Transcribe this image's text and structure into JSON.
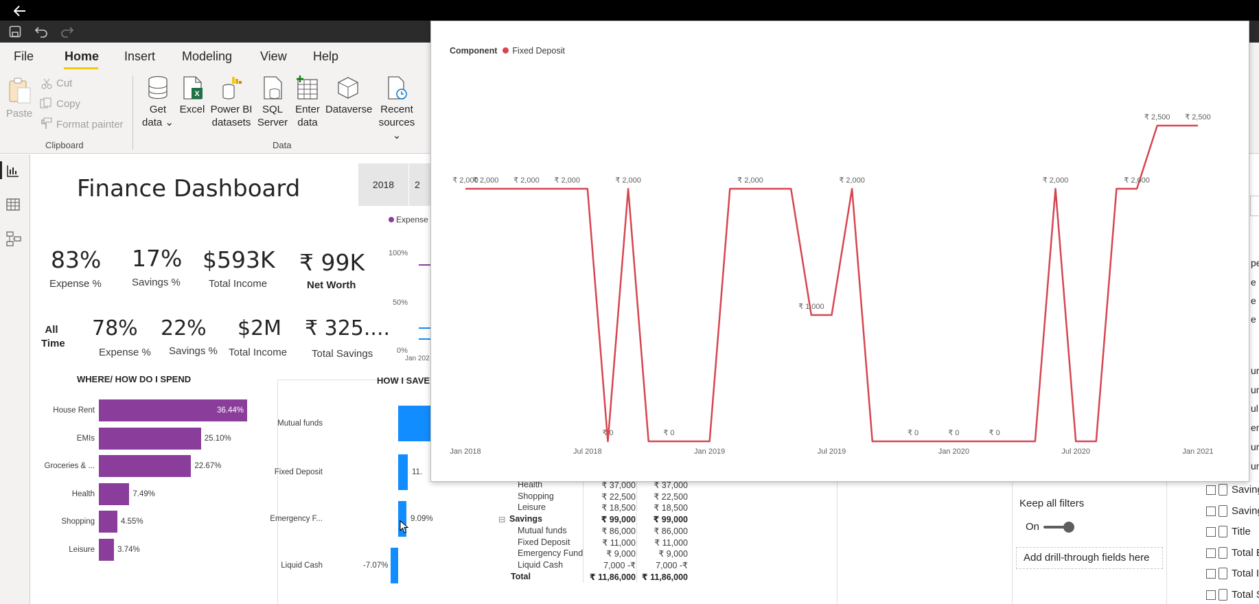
{
  "app": {
    "menu": [
      "File",
      "Home",
      "Insert",
      "Modeling",
      "View",
      "Help"
    ],
    "active_menu": "Home"
  },
  "ribbon": {
    "clipboard": {
      "paste": "Paste",
      "cut": "Cut",
      "copy": "Copy",
      "format_painter": "Format painter",
      "group": "Clipboard"
    },
    "data": {
      "group": "Data",
      "buttons": [
        {
          "line1": "Get",
          "line2": "data ⌄"
        },
        {
          "line1": "Excel",
          "line2": ""
        },
        {
          "line1": "Power BI",
          "line2": "datasets"
        },
        {
          "line1": "SQL",
          "line2": "Server"
        },
        {
          "line1": "Enter",
          "line2": "data"
        },
        {
          "line1": "Dataverse",
          "line2": ""
        },
        {
          "line1": "Recent",
          "line2": "sources ⌄"
        }
      ]
    }
  },
  "dashboard": {
    "title": "Finance Dashboard",
    "year_slicer": [
      "2018",
      "2"
    ],
    "legend_fragment": "Expense",
    "bg_axis": [
      "100%",
      "50%",
      "0%",
      "Jan 202"
    ],
    "kpis_period": [
      {
        "value": "83%",
        "label": "Expense %"
      },
      {
        "value": "17%",
        "label": "Savings %"
      },
      {
        "value": "$593K",
        "label": "Total Income"
      },
      {
        "value": "₹ 99K",
        "label": "Net Worth"
      }
    ],
    "all_time_label": [
      "All",
      "Time"
    ],
    "kpis_alltime": [
      {
        "value": "78%",
        "label": "Expense %"
      },
      {
        "value": "22%",
        "label": "Savings %"
      },
      {
        "value": "$2M",
        "label": "Total Income"
      },
      {
        "value": "₹ 325....",
        "label": "Total Savings"
      }
    ],
    "spend": {
      "title": "WHERE/ HOW DO I SPEND",
      "color": "#8a3d9b",
      "items": [
        {
          "label": "House Rent",
          "value": 36.44,
          "text": "36.44%"
        },
        {
          "label": "EMIs",
          "value": 25.1,
          "text": "25.10%"
        },
        {
          "label": "Groceries & ...",
          "value": 22.67,
          "text": "22.67%"
        },
        {
          "label": "Health",
          "value": 7.49,
          "text": "7.49%"
        },
        {
          "label": "Shopping",
          "value": 4.55,
          "text": "4.55%"
        },
        {
          "label": "Leisure",
          "value": 3.74,
          "text": "3.74%"
        }
      ]
    },
    "save": {
      "title": "HOW I SAVE",
      "color": "#118dff",
      "items": [
        {
          "label": "Mutual funds",
          "value": null,
          "text": ""
        },
        {
          "label": "Fixed Deposit",
          "value": 11,
          "text": "11."
        },
        {
          "label": "Emergency F...",
          "value": 9.09,
          "text": "9.09%"
        },
        {
          "label": "Liquid Cash",
          "value": -7.07,
          "text": "-7.07%"
        }
      ]
    },
    "matrix": {
      "rows": [
        {
          "label": "Health",
          "c1": "₹ 37,000",
          "c2": "₹ 37,000",
          "bold": false,
          "indent": true
        },
        {
          "label": "Shopping",
          "c1": "₹ 22,500",
          "c2": "₹ 22,500",
          "bold": false,
          "indent": true
        },
        {
          "label": "Leisure",
          "c1": "₹ 18,500",
          "c2": "₹ 18,500",
          "bold": false,
          "indent": true
        },
        {
          "label": "Savings",
          "c1": "₹ 99,000",
          "c2": "₹ 99,000",
          "bold": true,
          "indent": false,
          "toggle": "⊟"
        },
        {
          "label": "Mutual funds",
          "c1": "₹ 86,000",
          "c2": "₹ 86,000",
          "bold": false,
          "indent": true
        },
        {
          "label": "Fixed Deposit",
          "c1": "₹ 11,000",
          "c2": "₹ 11,000",
          "bold": false,
          "indent": true
        },
        {
          "label": "Emergency Fund",
          "c1": "₹ 9,000",
          "c2": "₹ 9,000",
          "bold": false,
          "indent": true
        },
        {
          "label": "Liquid Cash",
          "c1": "7,000 -₹",
          "c2": "7,000 -₹",
          "bold": false,
          "indent": true
        },
        {
          "label": "Total",
          "c1": "₹ 11,86,000",
          "c2": "₹ 11,86,000",
          "bold": true,
          "indent": false
        }
      ]
    }
  },
  "right_pane": {
    "keep_filters": "Keep all filters",
    "toggle_state": "On",
    "drill_through": "Add drill-through fields here",
    "fields": [
      "Saving",
      "Saving",
      "Title",
      "Total E",
      "Total In",
      "Total S"
    ],
    "edge_fragments": [
      "pe",
      "e",
      "e",
      "e",
      "ure",
      "um",
      "ul",
      "ens",
      "um",
      "um"
    ]
  },
  "chart_data": {
    "type": "line",
    "legend_title": "Component",
    "series": [
      {
        "name": "Fixed Deposit",
        "color": "#d64550",
        "x": [
          "2018-01",
          "2018-02",
          "2018-03",
          "2018-04",
          "2018-05",
          "2018-06",
          "2018-07",
          "2018-08",
          "2018-09",
          "2018-10",
          "2018-11",
          "2018-12",
          "2019-01",
          "2019-02",
          "2019-03",
          "2019-04",
          "2019-05",
          "2019-06",
          "2019-07",
          "2019-08",
          "2019-09",
          "2019-10",
          "2019-11",
          "2019-12",
          "2020-01",
          "2020-02",
          "2020-03",
          "2020-04",
          "2020-05",
          "2020-06",
          "2020-07",
          "2020-08",
          "2020-09",
          "2020-10",
          "2020-11",
          "2020-12",
          "2021-01"
        ],
        "values": [
          2000,
          2000,
          2000,
          2000,
          2000,
          2000,
          2000,
          0,
          2000,
          0,
          0,
          0,
          0,
          2000,
          2000,
          2000,
          2000,
          1000,
          1000,
          2000,
          0,
          0,
          0,
          0,
          0,
          0,
          0,
          0,
          0,
          2000,
          0,
          0,
          2000,
          2000,
          2500,
          2500,
          2500
        ],
        "labels": [
          "₹ 2,000",
          "₹ 2,000",
          "",
          "₹ 2,000",
          "",
          "₹ 2,000",
          "",
          "₹ 0",
          "₹ 2,000",
          "",
          "₹ 0",
          "",
          "",
          "",
          "₹ 2,000",
          "",
          "",
          "₹ 1,000",
          "",
          "₹ 2,000",
          "",
          "",
          "₹ 0",
          "",
          "₹ 0",
          "",
          "₹ 0",
          "",
          "",
          "₹ 2,000",
          "",
          "",
          "",
          "₹ 2,000",
          "₹ 2,500",
          "",
          "₹ 2,500"
        ]
      }
    ],
    "x_ticks": [
      {
        "x": "2018-01",
        "label": "Jan 2018"
      },
      {
        "x": "2018-07",
        "label": "Jul 2018"
      },
      {
        "x": "2019-01",
        "label": "Jan 2019"
      },
      {
        "x": "2019-07",
        "label": "Jul 2019"
      },
      {
        "x": "2020-01",
        "label": "Jan 2020"
      },
      {
        "x": "2020-07",
        "label": "Jul 2020"
      },
      {
        "x": "2021-01",
        "label": "Jan 2021"
      }
    ],
    "ylim": [
      0,
      2500
    ],
    "grid": false,
    "legend_position": "top-left"
  }
}
